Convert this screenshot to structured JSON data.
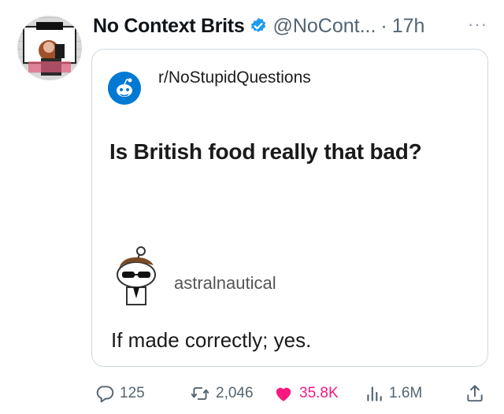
{
  "tweet": {
    "author_name": "No Context Brits",
    "handle": "@NoCont...",
    "separator": "·",
    "time": "17h",
    "more_label": "···"
  },
  "card": {
    "subreddit": "r/NoStupidQuestions",
    "question": "Is British food really that bad?",
    "commenter": "astralnautical",
    "comment": "If made correctly; yes."
  },
  "actions": {
    "replies": "125",
    "retweets": "2,046",
    "likes": "35.8K",
    "views": "1.6M"
  },
  "colors": {
    "verified": "#1d9bf0",
    "like": "#f91880",
    "reddit_blue": "#0079d3",
    "muted": "#536471"
  },
  "icons": [
    "verified-badge-icon",
    "more-icon",
    "reply-icon",
    "retweet-icon",
    "heart-icon",
    "views-icon",
    "share-icon"
  ]
}
